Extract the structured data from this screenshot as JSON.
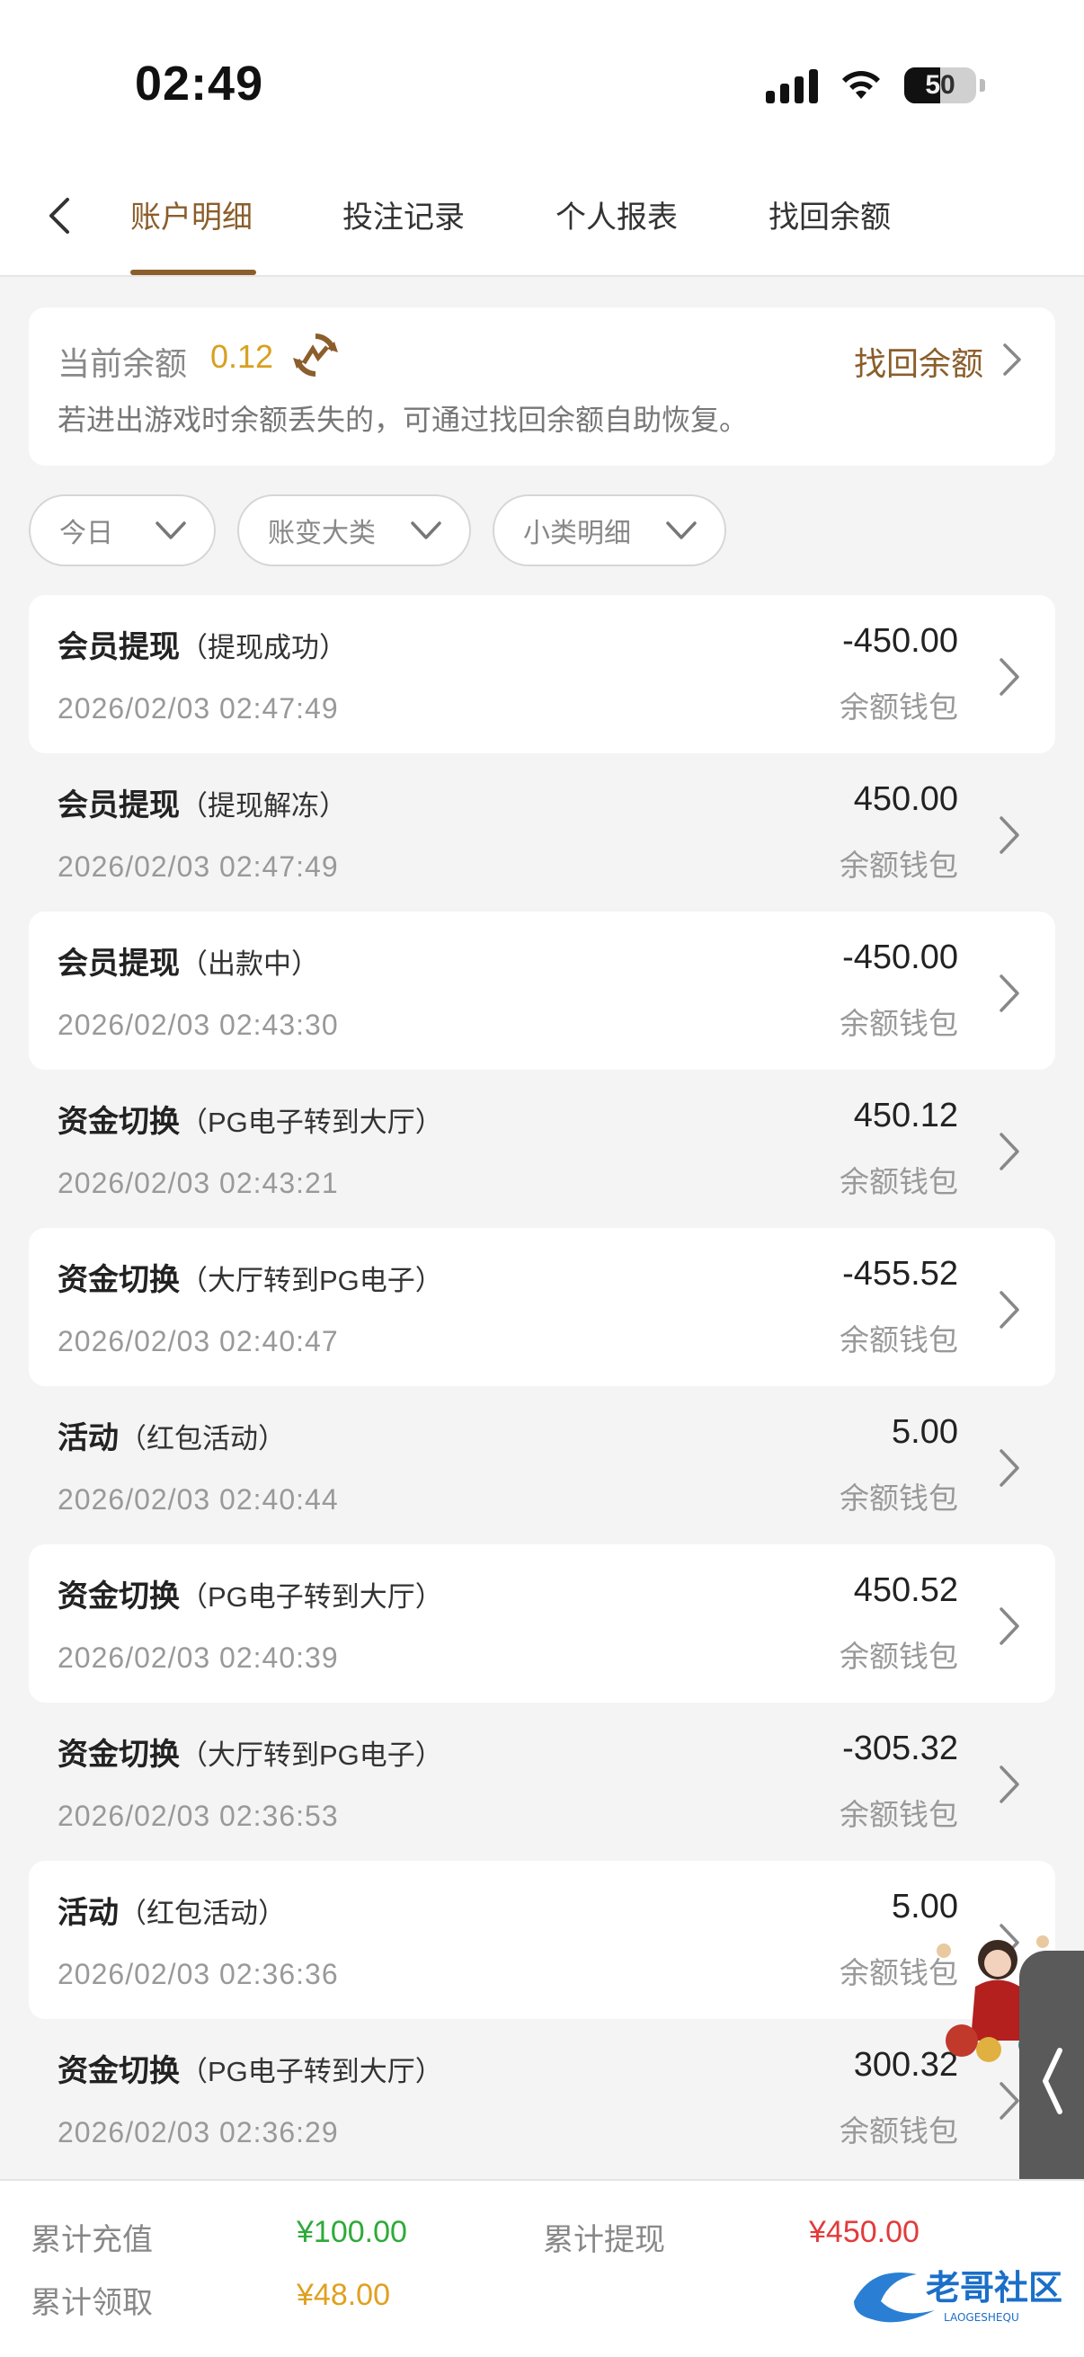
{
  "status": {
    "time": "02:49",
    "battery": "50"
  },
  "tabs": [
    {
      "label": "账户明细",
      "active": true
    },
    {
      "label": "投注记录",
      "active": false
    },
    {
      "label": "个人报表",
      "active": false
    },
    {
      "label": "找回余额",
      "active": false
    }
  ],
  "balance": {
    "label": "当前余额",
    "value": "0.12",
    "recover_label": "找回余额",
    "hint": "若进出游戏时余额丢失的，可通过找回余额自助恢复。"
  },
  "filters": [
    {
      "label": "今日"
    },
    {
      "label": "账变大类"
    },
    {
      "label": "小类明细"
    }
  ],
  "records": [
    {
      "title": "会员提现",
      "sub": "（提现成功）",
      "time": "2026/02/03 02:47:49",
      "amount": "-450.00",
      "wallet": "余额钱包"
    },
    {
      "title": "会员提现",
      "sub": "（提现解冻）",
      "time": "2026/02/03 02:47:49",
      "amount": "450.00",
      "wallet": "余额钱包"
    },
    {
      "title": "会员提现",
      "sub": "（出款中）",
      "time": "2026/02/03 02:43:30",
      "amount": "-450.00",
      "wallet": "余额钱包"
    },
    {
      "title": "资金切换",
      "sub": "（PG电子转到大厅）",
      "time": "2026/02/03 02:43:21",
      "amount": "450.12",
      "wallet": "余额钱包"
    },
    {
      "title": "资金切换",
      "sub": "（大厅转到PG电子）",
      "time": "2026/02/03 02:40:47",
      "amount": "-455.52",
      "wallet": "余额钱包"
    },
    {
      "title": "活动",
      "sub": "（红包活动）",
      "time": "2026/02/03 02:40:44",
      "amount": "5.00",
      "wallet": "余额钱包"
    },
    {
      "title": "资金切换",
      "sub": "（PG电子转到大厅）",
      "time": "2026/02/03 02:40:39",
      "amount": "450.52",
      "wallet": "余额钱包"
    },
    {
      "title": "资金切换",
      "sub": "（大厅转到PG电子）",
      "time": "2026/02/03 02:36:53",
      "amount": "-305.32",
      "wallet": "余额钱包"
    },
    {
      "title": "活动",
      "sub": "（红包活动）",
      "time": "2026/02/03 02:36:36",
      "amount": "5.00",
      "wallet": "余额钱包"
    },
    {
      "title": "资金切换",
      "sub": "（PG电子转到大厅）",
      "time": "2026/02/03 02:36:29",
      "amount": "300.32",
      "wallet": "余额钱包"
    }
  ],
  "footer": {
    "recharge_label": "累计充值",
    "recharge_value": "¥100.00",
    "withdraw_label": "累计提现",
    "withdraw_value": "¥450.00",
    "receive_label": "累计领取",
    "receive_value": "¥48.00"
  },
  "watermark": {
    "text": "老哥社区",
    "subtext": "LAOGESHEQU"
  },
  "colors": {
    "accent": "#8b5e2b",
    "balance": "#d9a020",
    "green": "#2eaa3a",
    "red": "#e23b3b"
  }
}
